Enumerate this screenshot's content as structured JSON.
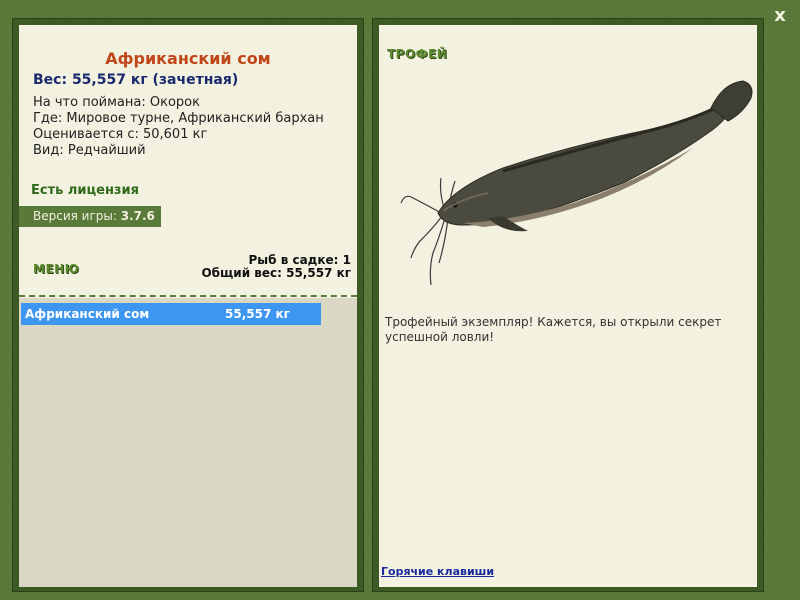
{
  "window": {
    "close_label": "x"
  },
  "left": {
    "title": "Африканский сом",
    "weight_line": "Вес: 55,557 кг (зачетная)",
    "info": [
      "На что поймана: Окорок",
      "Где: Мировое турне, Африканский бархан",
      "Оценивается с: 50,601 кг",
      "Вид: Редчайший"
    ],
    "license": "Есть лицензия",
    "version_prefix": "Версия игры: ",
    "version_value": "3.7.6",
    "menu_label": "МЕНЮ",
    "keep_count": "Рыб в садке: 1",
    "keep_weight": "Общий вес: 55,557 кг",
    "list": [
      {
        "name": "Африканский сом",
        "weight": "55,557 кг"
      }
    ]
  },
  "right": {
    "trophy_label": "ТРОФЕЙ",
    "fish_icon": "african-catfish-image",
    "trophy_text": "Трофейный экземпляр! Кажется, вы открыли секрет успешной ловли!",
    "hotkeys": "Горячие клавиши"
  },
  "colors": {
    "frame": "#5a7a3a",
    "panel": "#f3f1e0",
    "title": "#c0461a",
    "weight": "#1a2a6e",
    "selection": "#3d97f0"
  }
}
